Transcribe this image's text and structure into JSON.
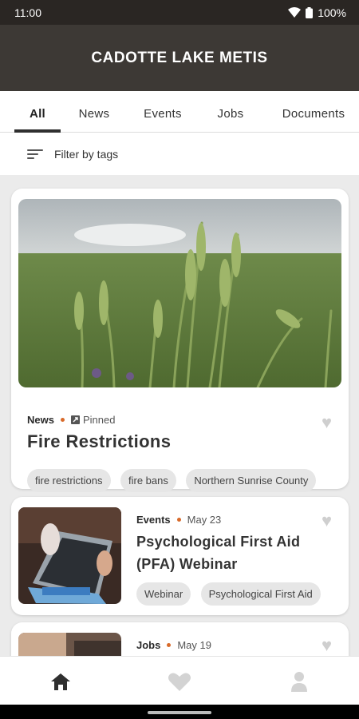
{
  "status_bar": {
    "time": "11:00",
    "battery": "100%"
  },
  "header": {
    "title": "CADOTTE LAKE METIS"
  },
  "tabs": [
    {
      "label": "All",
      "active": true
    },
    {
      "label": "News",
      "active": false
    },
    {
      "label": "Events",
      "active": false
    },
    {
      "label": "Jobs",
      "active": false
    },
    {
      "label": "Documents",
      "active": false
    }
  ],
  "filter": {
    "label": "Filter by tags"
  },
  "cards": [
    {
      "type": "News",
      "badge": "Pinned",
      "title": "Fire Restrictions",
      "tags": [
        "fire restrictions",
        "fire bans",
        "Northern Sunrise County"
      ],
      "image": "wheat-field-photo"
    },
    {
      "type": "Events",
      "date": "May 23",
      "title": "Psychological First Aid (PFA) Webinar",
      "tags": [
        "Webinar",
        "Psychological First Aid"
      ],
      "image": "laptop-photo"
    },
    {
      "type": "Jobs",
      "date": "May 19",
      "image": "desk-photo"
    }
  ],
  "bottom_nav": [
    {
      "icon": "home-icon",
      "active": true
    },
    {
      "icon": "heart-icon",
      "active": false
    },
    {
      "icon": "person-icon",
      "active": false
    }
  ],
  "colors": {
    "header_bg": "#3d3935",
    "accent_dot": "#d86a2a",
    "status_bg": "#2a2623"
  }
}
